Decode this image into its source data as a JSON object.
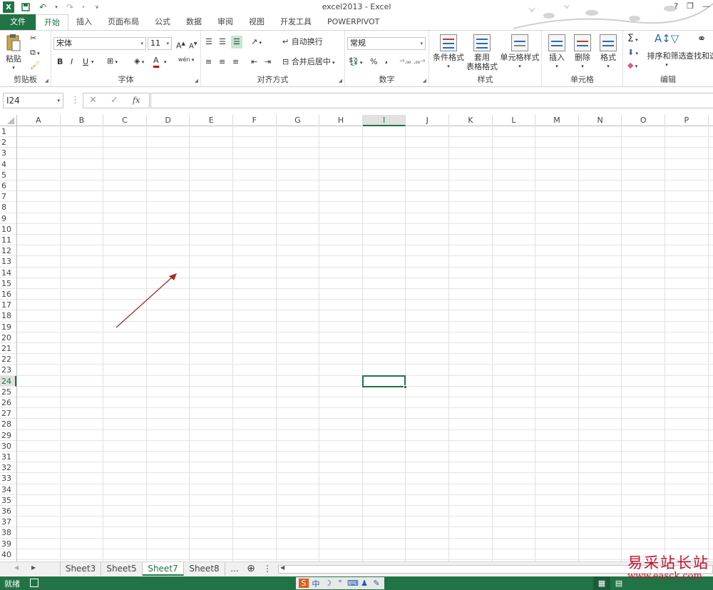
{
  "window": {
    "title": "excel2013 - Excel",
    "help": "?",
    "minimize": "—",
    "restore": "❐",
    "close": "✕"
  },
  "qat": {
    "save": "save-icon",
    "undo": "undo-icon",
    "redo": "redo-icon"
  },
  "tabs": [
    "文件",
    "开始",
    "插入",
    "页面布局",
    "公式",
    "数据",
    "审阅",
    "视图",
    "开发工具",
    "POWERPIVOT"
  ],
  "active_tab": "开始",
  "ribbon": {
    "clipboard": {
      "label": "剪贴板",
      "paste": "粘贴"
    },
    "font": {
      "label": "字体",
      "font_name": "宋体",
      "font_size": "11",
      "bold": "B",
      "italic": "I",
      "underline": "U",
      "grow": "A",
      "shrink": "A",
      "fontcolor": "A",
      "phonetic": "wén"
    },
    "alignment": {
      "label": "对齐方式",
      "wrap_text": "自动换行",
      "merge_center": "合并后居中"
    },
    "number": {
      "label": "数字",
      "format": "常规",
      "percent": "%",
      "comma": ","
    },
    "styles": {
      "label": "样式",
      "conditional": "条件格式",
      "table_format_1": "套用",
      "table_format_2": "表格格式",
      "cell_styles": "单元格样式"
    },
    "cells": {
      "label": "单元格",
      "insert": "插入",
      "delete": "删除",
      "format": "格式"
    },
    "editing": {
      "label": "编辑",
      "sum": "Σ",
      "sort_filter": "排序和筛选",
      "find_select": "查找和选"
    }
  },
  "formula_bar": {
    "name_box": "I24",
    "cancel": "✕",
    "enter": "✓",
    "fx": "fx",
    "value": ""
  },
  "columns": [
    "A",
    "B",
    "C",
    "D",
    "E",
    "F",
    "G",
    "H",
    "I",
    "J",
    "K",
    "L",
    "M",
    "N",
    "O",
    "P"
  ],
  "selected_column": "I",
  "rows": [
    "1",
    "2",
    "3",
    "4",
    "5",
    "6",
    "7",
    "8",
    "9",
    "10",
    "11",
    "12",
    "13",
    "14",
    "15",
    "16",
    "17",
    "18",
    "19",
    "20",
    "21",
    "22",
    "23",
    "24",
    "25",
    "26",
    "27",
    "28",
    "29",
    "30",
    "31",
    "32",
    "33",
    "34",
    "35",
    "36",
    "37",
    "38",
    "39",
    "40"
  ],
  "selected_row": "24",
  "selected_cell": "I24",
  "sheets": [
    "Sheet3",
    "Sheet5",
    "Sheet7",
    "Sheet8"
  ],
  "active_sheet": "Sheet7",
  "sheet_more": "...",
  "add_sheet": "⊕",
  "status": "就绪",
  "ime": [
    "S",
    "中",
    "☽",
    "°",
    "⌨",
    "♟",
    "✎"
  ],
  "watermark": "易采站长站",
  "watermark_url": "www.easck.com",
  "colors": {
    "excel_green": "#217346",
    "arrow": "#a52a2a",
    "watermark": "#c8102e"
  }
}
